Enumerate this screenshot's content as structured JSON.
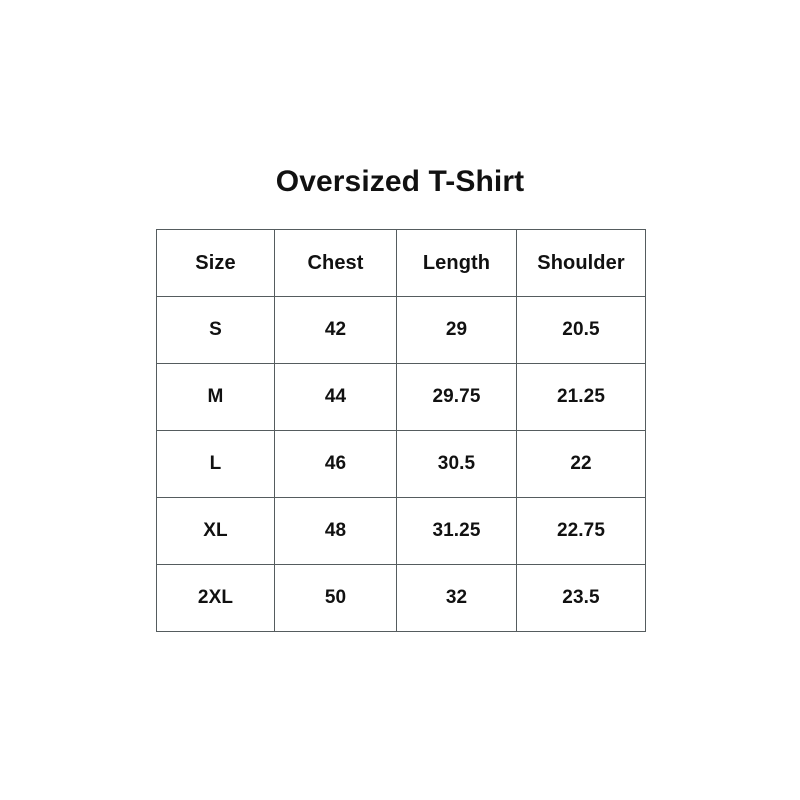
{
  "title": "Oversized T-Shirt",
  "table": {
    "columns": [
      "Size",
      "Chest",
      "Length",
      "Shoulder"
    ],
    "rows": [
      {
        "size": "S",
        "chest": "42",
        "length": "29",
        "shoulder": "20.5"
      },
      {
        "size": "M",
        "chest": "44",
        "length": "29.75",
        "shoulder": "21.25"
      },
      {
        "size": "L",
        "chest": "46",
        "length": "30.5",
        "shoulder": "22"
      },
      {
        "size": "XL",
        "chest": "48",
        "length": "31.25",
        "shoulder": "22.75"
      },
      {
        "size": "2XL",
        "chest": "50",
        "length": "32",
        "shoulder": "23.5"
      }
    ]
  },
  "colors": {
    "background": "#ffffff",
    "text": "#111111",
    "border": "#555c5e"
  }
}
